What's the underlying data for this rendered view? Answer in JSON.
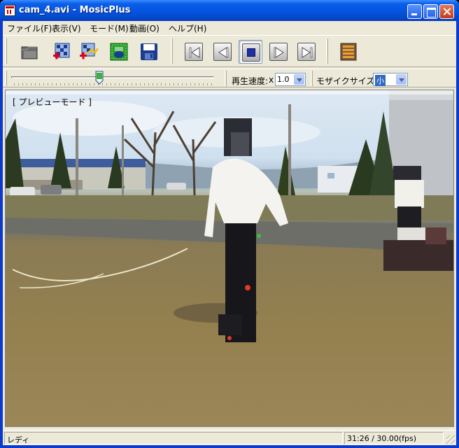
{
  "window": {
    "title": "cam_4.avi - MosicPlus"
  },
  "menu": [
    "ファイル(F)",
    "表示(V)",
    "モード(M)",
    "動画(O)",
    "ヘルプ(H)"
  ],
  "toolbar": {
    "buttons": [
      "open-icon",
      "add-grid-icon",
      "add-track-icon",
      "face-mosaic-icon",
      "save-icon",
      "skip-to-start-icon",
      "step-back-icon",
      "stop-icon",
      "step-forward-icon",
      "skip-to-end-icon",
      "list-icon"
    ]
  },
  "playback": {
    "position": 0.43,
    "speed_label": "再生速度:",
    "speed_prefix": "x",
    "speed_value": "1.0",
    "mosaic_label": "モザイクサイズ:",
    "mosaic_value": "小"
  },
  "video": {
    "mode_label": "[ プレビューモード ]"
  },
  "status": {
    "left": "レディ",
    "time": "31:26 / 30.00(fps)"
  },
  "colors": {
    "titlebar": "#0553e0",
    "accent": "#316ac5",
    "face": "#ece9d8"
  }
}
